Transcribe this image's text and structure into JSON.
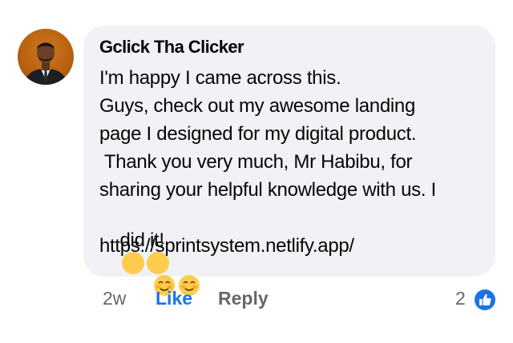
{
  "comment": {
    "author": "Gclick Tha Clicker",
    "text_lines": [
      "I'm happy I came across this.",
      "Guys, check out my awesome landing",
      "page I designed for my digital product.",
      " Thank you very much, Mr Habibu, for",
      "sharing your helpful knowledge with us. I",
      "did it!",
      "https://sprintsystem.netlify.app/"
    ],
    "emojis": [
      "smiling-face-icon",
      "smiling-face-icon"
    ],
    "timestamp": "2w",
    "like_label": "Like",
    "reply_label": "Reply",
    "reaction_count": "2",
    "reaction_type": "like-thumb-icon"
  },
  "colors": {
    "bubble_bg": "#f0f2f5",
    "like_blue": "#1b74e4",
    "secondary_text": "#65676b",
    "avatar_bg": "#c8691a"
  }
}
